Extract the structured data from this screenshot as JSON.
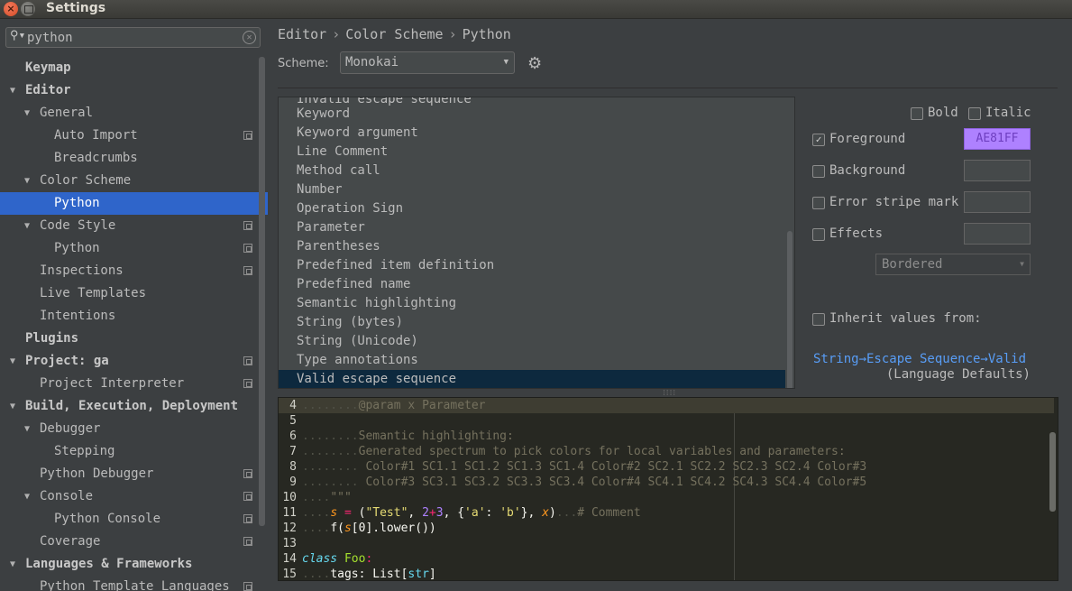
{
  "window": {
    "title": "Settings"
  },
  "search": {
    "value": "python"
  },
  "tree": [
    {
      "label": "Keymap",
      "bold": true
    },
    {
      "label": "Editor",
      "bold": true,
      "expanded": true
    },
    {
      "label": "General",
      "expanded": true
    },
    {
      "label": "Auto Import",
      "copy": true
    },
    {
      "label": "Breadcrumbs"
    },
    {
      "label": "Color Scheme",
      "expanded": true
    },
    {
      "label": "Python",
      "selected": true
    },
    {
      "label": "Code Style",
      "expanded": true,
      "copy": true
    },
    {
      "label": "Python",
      "copy": true
    },
    {
      "label": "Inspections",
      "copy": true
    },
    {
      "label": "Live Templates"
    },
    {
      "label": "Intentions"
    },
    {
      "label": "Plugins",
      "bold": true
    },
    {
      "label": "Project: ga",
      "bold": true,
      "expanded": true,
      "copy": true
    },
    {
      "label": "Project Interpreter",
      "copy": true
    },
    {
      "label": "Build, Execution, Deployment",
      "bold": true,
      "expanded": true
    },
    {
      "label": "Debugger",
      "expanded": true
    },
    {
      "label": "Stepping"
    },
    {
      "label": "Python Debugger",
      "copy": true
    },
    {
      "label": "Console",
      "expanded": true,
      "copy": true
    },
    {
      "label": "Python Console",
      "copy": true
    },
    {
      "label": "Coverage",
      "copy": true
    },
    {
      "label": "Languages & Frameworks",
      "bold": true,
      "expanded": true
    },
    {
      "label": "Python Template Languages",
      "copy": true
    }
  ],
  "breadcrumb": [
    "Editor",
    "Color Scheme",
    "Python"
  ],
  "breadcrumb_sep": "›",
  "scheme": {
    "label": "Scheme:",
    "value": "Monokai"
  },
  "attributes": {
    "partial_top": "Invalid escape sequence",
    "items": [
      "Keyword",
      "Keyword argument",
      "Line Comment",
      "Method call",
      "Number",
      "Operation Sign",
      "Parameter",
      "Parentheses",
      "Predefined item definition",
      "Predefined name",
      "Semantic highlighting",
      "String (bytes)",
      "String (Unicode)",
      "Type annotations",
      "Valid escape sequence"
    ],
    "selected": "Valid escape sequence"
  },
  "props": {
    "bold": {
      "label": "Bold",
      "checked": false
    },
    "italic": {
      "label": "Italic",
      "checked": false
    },
    "foreground": {
      "label": "Foreground",
      "checked": true,
      "value": "AE81FF",
      "color": "#ae81ff"
    },
    "background": {
      "label": "Background",
      "checked": false,
      "value": ""
    },
    "error_stripe": {
      "label": "Error stripe mark",
      "checked": false,
      "value": ""
    },
    "effects": {
      "label": "Effects",
      "checked": false,
      "value": "",
      "type": "Bordered"
    },
    "inherit": {
      "label": "Inherit values from:",
      "checked": false
    },
    "inherit_link": "String→Escape Sequence→Valid",
    "inherit_sub": "(Language Defaults)"
  },
  "editor": {
    "line_numbers": [
      "4",
      "5",
      "6",
      "7",
      "8",
      "9",
      "10",
      "11",
      "12",
      "13",
      "14",
      "15"
    ],
    "lines": {
      "l4": "@param x Parameter",
      "l6": "Semantic highlighting:",
      "l7": "Generated spectrum to pick colors for local variables and parameters:",
      "l8": " Color#1 SC1.1 SC1.2 SC1.3 SC1.4 Color#2 SC2.1 SC2.2 SC2.3 SC2.4 Color#3",
      "l9": " Color#3 SC3.1 SC3.2 SC3.3 SC3.4 Color#4 SC4.1 SC4.2 SC4.3 SC4.4 Color#5",
      "l10": "\"\"\"",
      "l11_s": "s",
      "l11_eq": " = ",
      "l11_open": "(",
      "l11_str": "\"Test\"",
      "l11_c1": ", ",
      "l11_n1": "2",
      "l11_plus": "+",
      "l11_n2": "3",
      "l11_c2": ", {",
      "l11_a": "'a'",
      "l11_colon": ": ",
      "l11_b": "'b'",
      "l11_c3": "}, ",
      "l11_x": "x",
      "l11_close": ")",
      "l11_comment": "# Comment",
      "l12_f": "f(",
      "l12_s": "s",
      "l12_rest": "[0].lower())",
      "l14_class": "class",
      "l14_name": "Foo",
      "l14_colon": ":",
      "l15_tags": "tags",
      "l15_colon": ": List[",
      "l15_str": "str",
      "l15_close": "]"
    },
    "colors": {
      "background": "#272822",
      "comment": "#75715e",
      "keyword": "#66d9ef",
      "string": "#e6db74",
      "number": "#ae81ff",
      "operator": "#f92672",
      "class": "#a6e22e",
      "parameter": "#fd971f"
    }
  }
}
